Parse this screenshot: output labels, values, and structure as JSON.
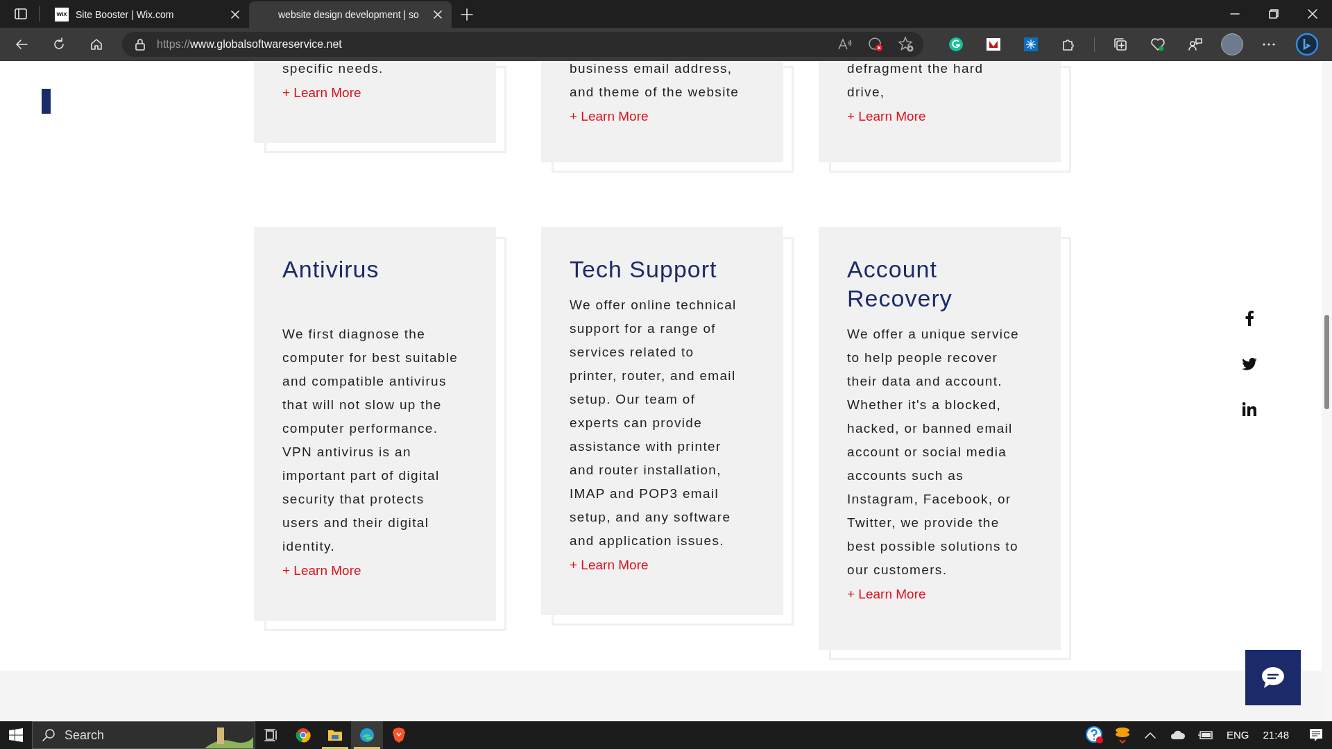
{
  "browser": {
    "tabs": [
      {
        "favicon_text": "WIX",
        "title": "Site Booster | Wix.com",
        "selected": false
      },
      {
        "title": "website design development | so",
        "selected": true
      }
    ],
    "url_scheme": "https://",
    "url_host": "www.globalsoftwareservice.net"
  },
  "top_cards": [
    {
      "body": "specific needs.",
      "link": "+ Learn More"
    },
    {
      "body": "business email address, and theme of the website",
      "link": "+ Learn More"
    },
    {
      "body": "defragment the hard drive,",
      "link": "+ Learn More"
    }
  ],
  "cards": [
    {
      "title": "Antivirus",
      "body": "We first diagnose the computer for best suitable and compatible antivirus that will not slow up the computer performance. VPN antivirus is an important part of digital security that protects users and their digital identity.",
      "link": "+ Learn More"
    },
    {
      "title": "Tech Support",
      "body": "We offer online technical support for a range of services related to printer, router, and email setup. Our team of experts can provide assistance with printer and router installation, IMAP and POP3 email setup, and any software and application issues.",
      "link": "+ Learn More"
    },
    {
      "title": "Account Recovery",
      "body": "We offer a unique service to help people recover their data and account. Whether it's a blocked, hacked, or banned email account or social media accounts such as Instagram, Facebook, or Twitter, we provide the best possible solutions to our customers.",
      "link": "+ Learn More"
    }
  ],
  "taskbar": {
    "search_placeholder": "Search",
    "language": "ENG",
    "time": "21:48"
  }
}
